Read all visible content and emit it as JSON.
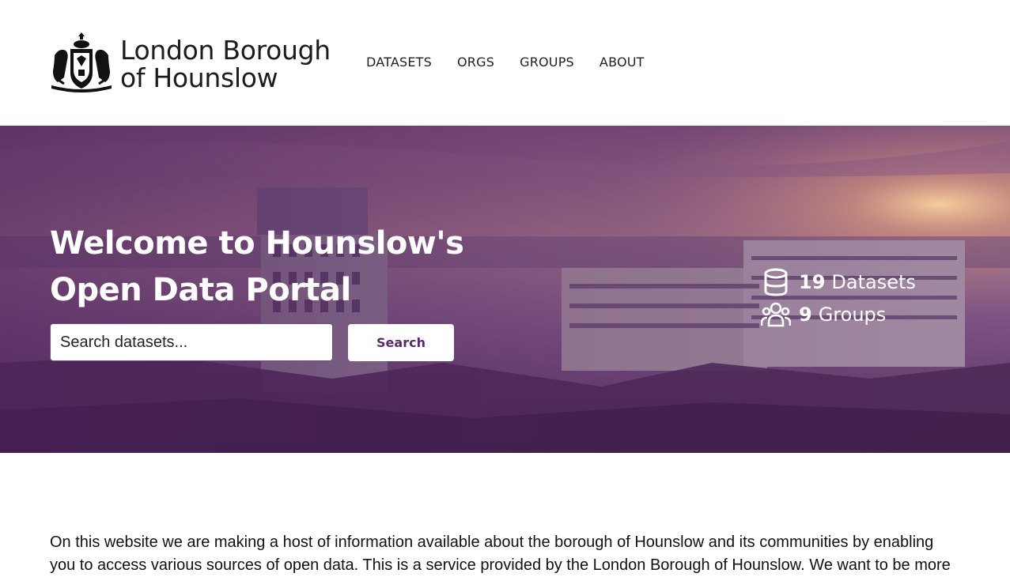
{
  "header": {
    "logo_line1": "London Borough",
    "logo_line2": "of Hounslow",
    "nav": [
      {
        "label": "DATASETS"
      },
      {
        "label": "ORGS"
      },
      {
        "label": "GROUPS"
      },
      {
        "label": "ABOUT"
      }
    ]
  },
  "hero": {
    "title_line1": "Welcome to Hounslow's",
    "title_line2": "Open Data Portal",
    "search_placeholder": "Search datasets...",
    "search_button": "Search",
    "stats": {
      "datasets_count": "19",
      "datasets_label": "Datasets",
      "groups_count": "9",
      "groups_label": "Groups"
    },
    "overlay_color": "#5b2a6e"
  },
  "intro": {
    "text": "On this website we are making a host of information available about the borough of Hounslow and its communities by enabling you to access various sources of open data. This is a service provided by the London Borough of Hounslow. We want to be more"
  },
  "icons": {
    "crest": "borough-crest-icon",
    "datasets": "database-icon",
    "groups": "users-group-icon"
  }
}
